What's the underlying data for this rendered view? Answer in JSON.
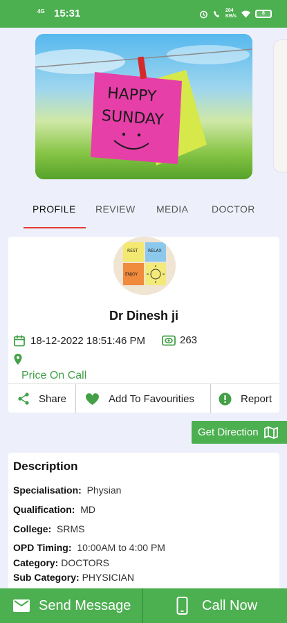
{
  "status_bar": {
    "network": "4G",
    "time": "15:31",
    "speed": "204 KB/s",
    "battery": "8"
  },
  "banner": {
    "note_line1": "HAPPY",
    "note_line2": "SUNDAY"
  },
  "tabs": [
    {
      "label": "PROFILE",
      "active": true
    },
    {
      "label": "REVIEW",
      "active": false
    },
    {
      "label": "MEDIA",
      "active": false
    },
    {
      "label": "DOCTOR",
      "active": false
    }
  ],
  "avatar": {
    "note_labels": [
      "REST",
      "RELAX",
      "ENJOY"
    ]
  },
  "profile": {
    "name": "Dr Dinesh ji",
    "datetime": "18-12-2022 18:51:46 PM",
    "views": "263",
    "price": "Price On Call"
  },
  "actions": {
    "share": "Share",
    "favourite": "Add To Favourities",
    "report": "Report"
  },
  "get_direction": "Get Direction",
  "description": {
    "title": "Description",
    "rows": [
      {
        "label": "Specialisation:",
        "value": "Physian"
      },
      {
        "label": "Qualification:",
        "value": "MD"
      },
      {
        "label": "College:",
        "value": "SRMS"
      },
      {
        "label": "OPD Timing:",
        "value": "10:00AM to 4:00 PM"
      },
      {
        "label": "Category:",
        "value": "DOCTORS"
      },
      {
        "label": "Sub Category:",
        "value": "PHYSICIAN"
      }
    ]
  },
  "bottom_bar": {
    "send_message": "Send Message",
    "call_now": "Call Now"
  },
  "colors": {
    "primary_green": "#4caf50",
    "tab_underline": "#e53935",
    "price_green": "#43a047",
    "background": "#edf0fb"
  }
}
